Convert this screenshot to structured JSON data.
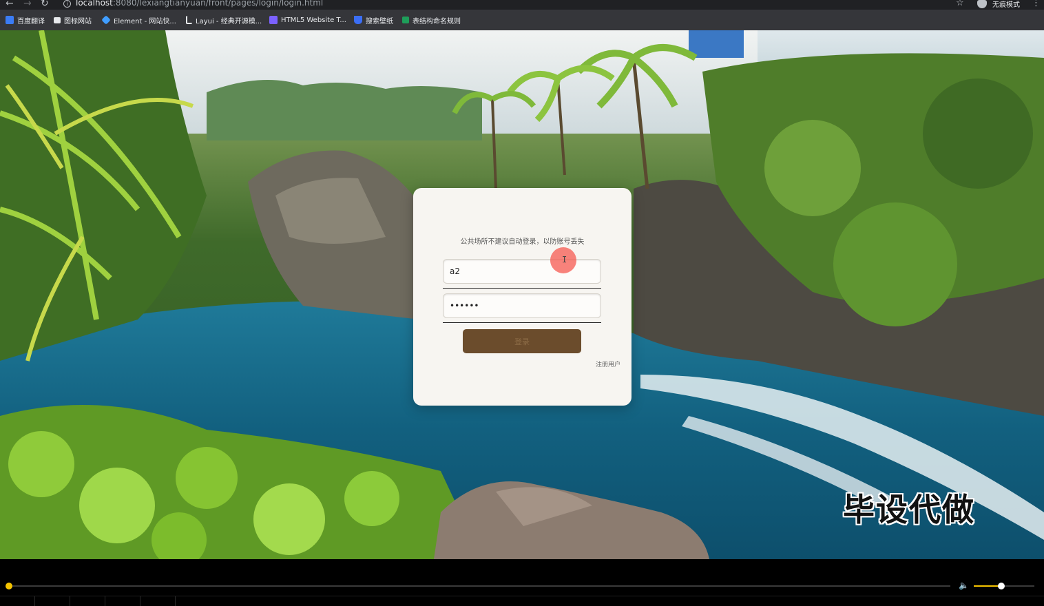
{
  "browser": {
    "url_host": "localhost",
    "url_rest": ":8080/lexiangtianyuan/front/pages/login/login.html",
    "mode_label": "无痕模式"
  },
  "bookmarks": [
    {
      "label": "百度翻译",
      "icon": "translate-icon",
      "color": "#3b7cf5"
    },
    {
      "label": "图标网站",
      "icon": "flag-icon",
      "color": "#e8eaed"
    },
    {
      "label": "Element - 网站快...",
      "icon": "element-icon",
      "color": "#409eff"
    },
    {
      "label": "Layui - 经典开源模...",
      "icon": "layui-icon",
      "color": "#e8eaed"
    },
    {
      "label": "HTML5 Website T...",
      "icon": "html5-icon",
      "color": "#7b61ff"
    },
    {
      "label": "搜索壁纸",
      "icon": "wallpaper-icon",
      "color": "#3b6ef5"
    },
    {
      "label": "表结构命名规则",
      "icon": "sheet-icon",
      "color": "#1e9e5a"
    }
  ],
  "login": {
    "notice": "公共场所不建议自动登录，以防账号丢失",
    "username": "a2",
    "password": "123456",
    "submit_label": "登录",
    "register_label": "注册用户"
  },
  "watermark": "毕设代做",
  "player": {
    "progress": 0.0,
    "volume": 0.45
  }
}
